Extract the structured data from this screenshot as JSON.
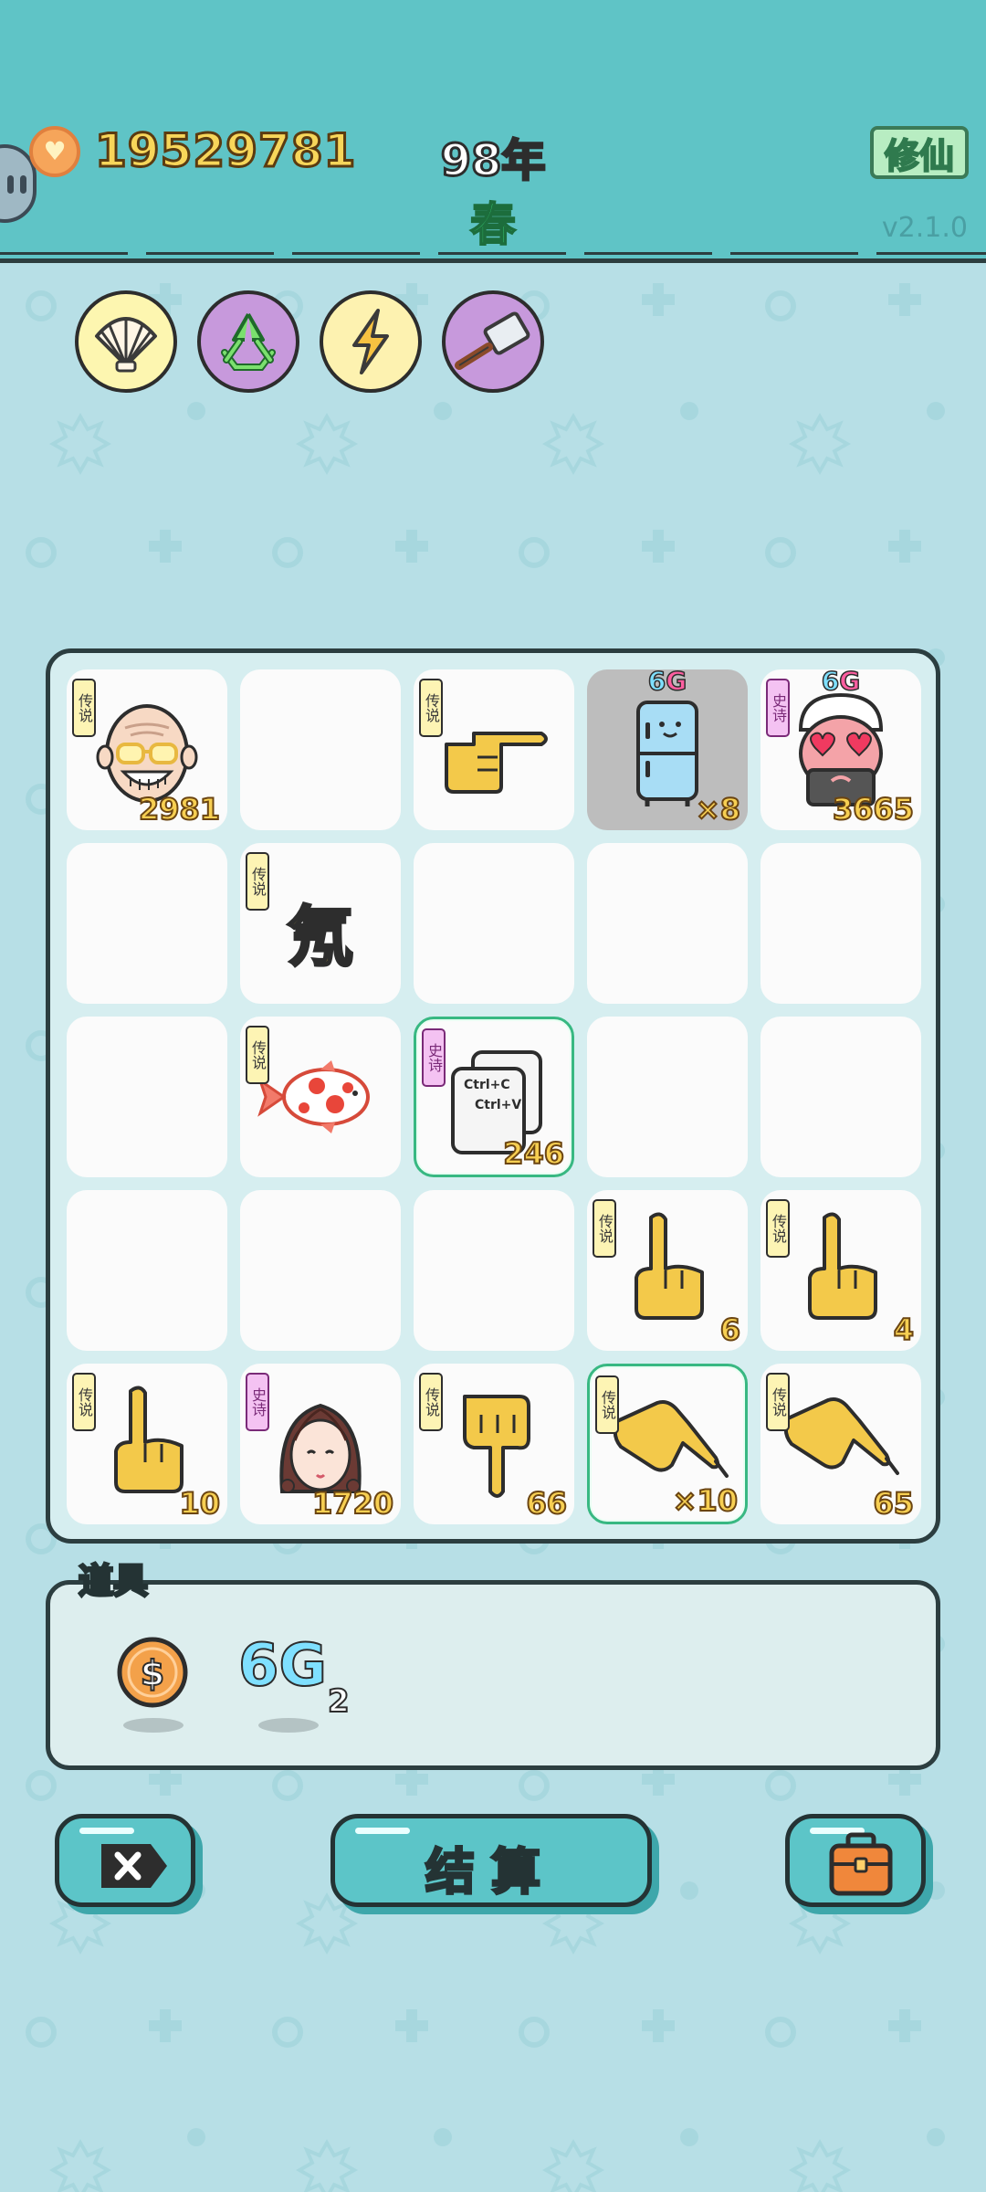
{
  "header": {
    "coins": "19529781",
    "year": "98年",
    "season": "春",
    "cultivate_label": "修仙",
    "version": "v2.1.0"
  },
  "skills": [
    {
      "name": "shell-icon",
      "bg": "#fdf6b0"
    },
    {
      "name": "recycle-icon",
      "bg": "#c799dc"
    },
    {
      "name": "lightning-icon",
      "bg": "#fdf2b0"
    },
    {
      "name": "cleaver-icon",
      "bg": "#c799dc"
    }
  ],
  "board": {
    "cells": [
      {
        "row": 0,
        "col": 0,
        "tag": "传说",
        "rarity": "legend",
        "icon": "old-man-icon",
        "count": "2981"
      },
      {
        "row": 0,
        "col": 1
      },
      {
        "row": 0,
        "col": 2,
        "tag": "传说",
        "rarity": "legend",
        "icon": "point-right-hand-icon",
        "count": ""
      },
      {
        "row": 0,
        "col": 3,
        "icon": "fridge-icon",
        "count": "×8",
        "badge": "6G",
        "gray": true
      },
      {
        "row": 0,
        "col": 4,
        "tag": "史诗",
        "rarity": "epic",
        "icon": "heart-eyes-man-icon",
        "count": "3665",
        "badge": "6G"
      },
      {
        "row": 1,
        "col": 0
      },
      {
        "row": 1,
        "col": 1,
        "tag": "传说",
        "rarity": "legend",
        "icon": "neon-character-icon",
        "char": "氖",
        "count": ""
      },
      {
        "row": 1,
        "col": 2
      },
      {
        "row": 1,
        "col": 3
      },
      {
        "row": 1,
        "col": 4
      },
      {
        "row": 2,
        "col": 0
      },
      {
        "row": 2,
        "col": 1,
        "tag": "传说",
        "rarity": "legend",
        "icon": "koi-fish-icon",
        "count": ""
      },
      {
        "row": 2,
        "col": 2,
        "tag": "史诗",
        "rarity": "epic",
        "icon": "copy-paste-icon",
        "count": "246",
        "selected": true,
        "lines": [
          "Ctrl+C",
          "Ctrl+V"
        ]
      },
      {
        "row": 2,
        "col": 3
      },
      {
        "row": 2,
        "col": 4
      },
      {
        "row": 3,
        "col": 0
      },
      {
        "row": 3,
        "col": 1
      },
      {
        "row": 3,
        "col": 2
      },
      {
        "row": 3,
        "col": 3,
        "tag": "传说",
        "rarity": "legend",
        "icon": "point-up-hand-icon",
        "count": "6"
      },
      {
        "row": 3,
        "col": 4,
        "tag": "传说",
        "rarity": "legend",
        "icon": "point-up-hand-icon",
        "count": "4"
      },
      {
        "row": 4,
        "col": 0,
        "tag": "传说",
        "rarity": "legend",
        "icon": "point-up-hand-icon",
        "count": "10"
      },
      {
        "row": 4,
        "col": 1,
        "tag": "史诗",
        "rarity": "epic",
        "icon": "braided-girl-icon",
        "count": "1720"
      },
      {
        "row": 4,
        "col": 2,
        "tag": "传说",
        "rarity": "legend",
        "icon": "point-down-hand-icon",
        "count": "66"
      },
      {
        "row": 4,
        "col": 3,
        "tag": "传说",
        "rarity": "legend",
        "icon": "point-down-right-hand-icon",
        "count": "×10",
        "selected": true
      },
      {
        "row": 4,
        "col": 4,
        "tag": "传说",
        "rarity": "legend",
        "icon": "point-down-right-hand-icon",
        "count": "65"
      }
    ]
  },
  "items": {
    "title": "道具",
    "list": [
      {
        "name": "dollar-coin-icon",
        "count": ""
      },
      {
        "name": "6g-icon",
        "text": "6G",
        "count": "2"
      }
    ]
  },
  "buttons": {
    "close_name": "close-button",
    "settle_label": "结算",
    "bag_name": "bag-button"
  }
}
